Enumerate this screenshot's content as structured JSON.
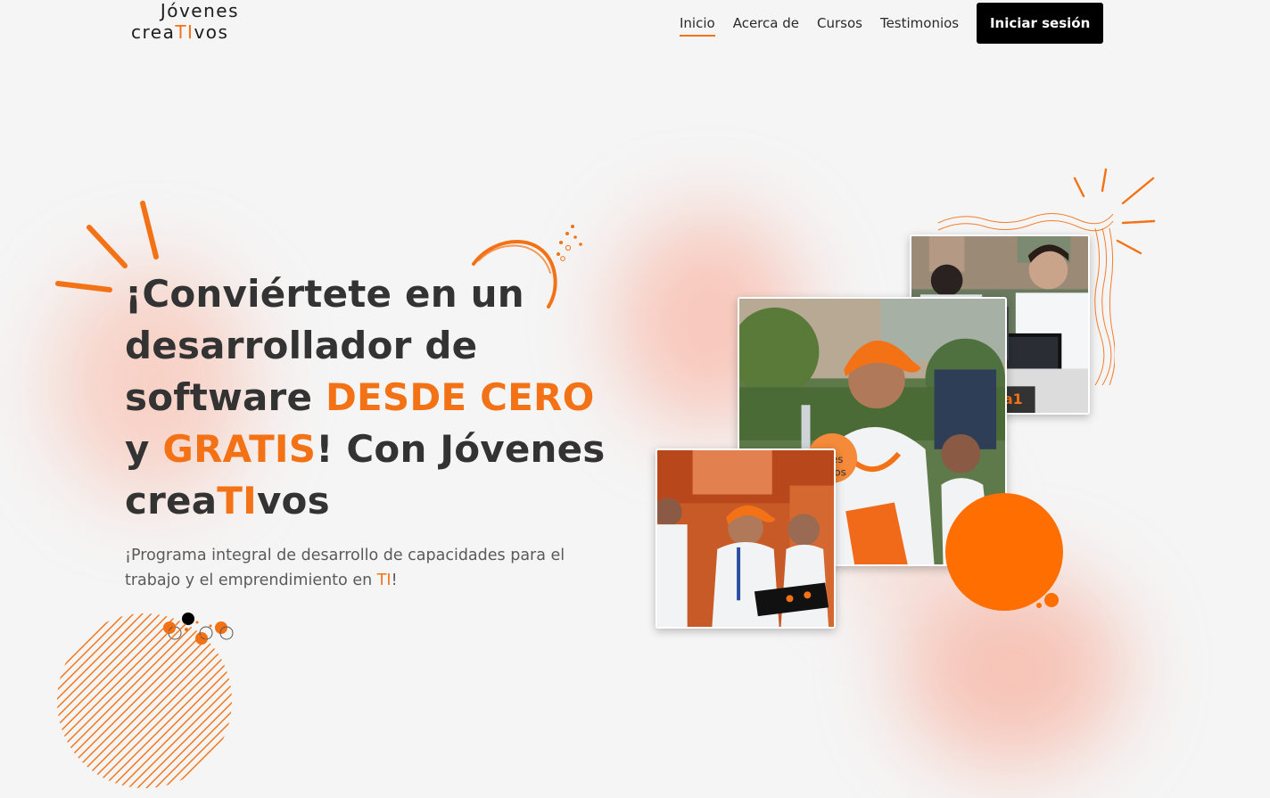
{
  "header": {
    "logo": {
      "line1": "Jóvenes",
      "line2_prefix": "crea",
      "line2_accent": "TI",
      "line2_suffix": "vos"
    },
    "nav": [
      {
        "label": "Inicio",
        "active": true
      },
      {
        "label": "Acerca de",
        "active": false
      },
      {
        "label": "Cursos",
        "active": false
      },
      {
        "label": "Testimonios",
        "active": false
      }
    ],
    "login_label": "Iniciar sesión"
  },
  "hero": {
    "title_part1": "¡Conviértete en un desarrollador de software ",
    "title_hl1": "DESDE CERO",
    "title_part2": " y ",
    "title_hl2": "GRATIS",
    "title_part3": "! Con Jóvenes crea",
    "title_hl3": "TI",
    "title_part4": "vos",
    "subtitle_part1": "¡Programa integral de desarrollo de capacidades para el trabajo y el emprendimiento en ",
    "subtitle_hl": "TI",
    "subtitle_part2": "!"
  },
  "images": {
    "back_alt": "students-at-laptops-photo",
    "main_alt": "student-in-orange-cap-photo",
    "front_alt": "students-with-laptop-photo"
  },
  "colors": {
    "accent": "#f47216",
    "dark": "#000000",
    "background": "#f5f5f5",
    "circle": "#ff6e00"
  }
}
